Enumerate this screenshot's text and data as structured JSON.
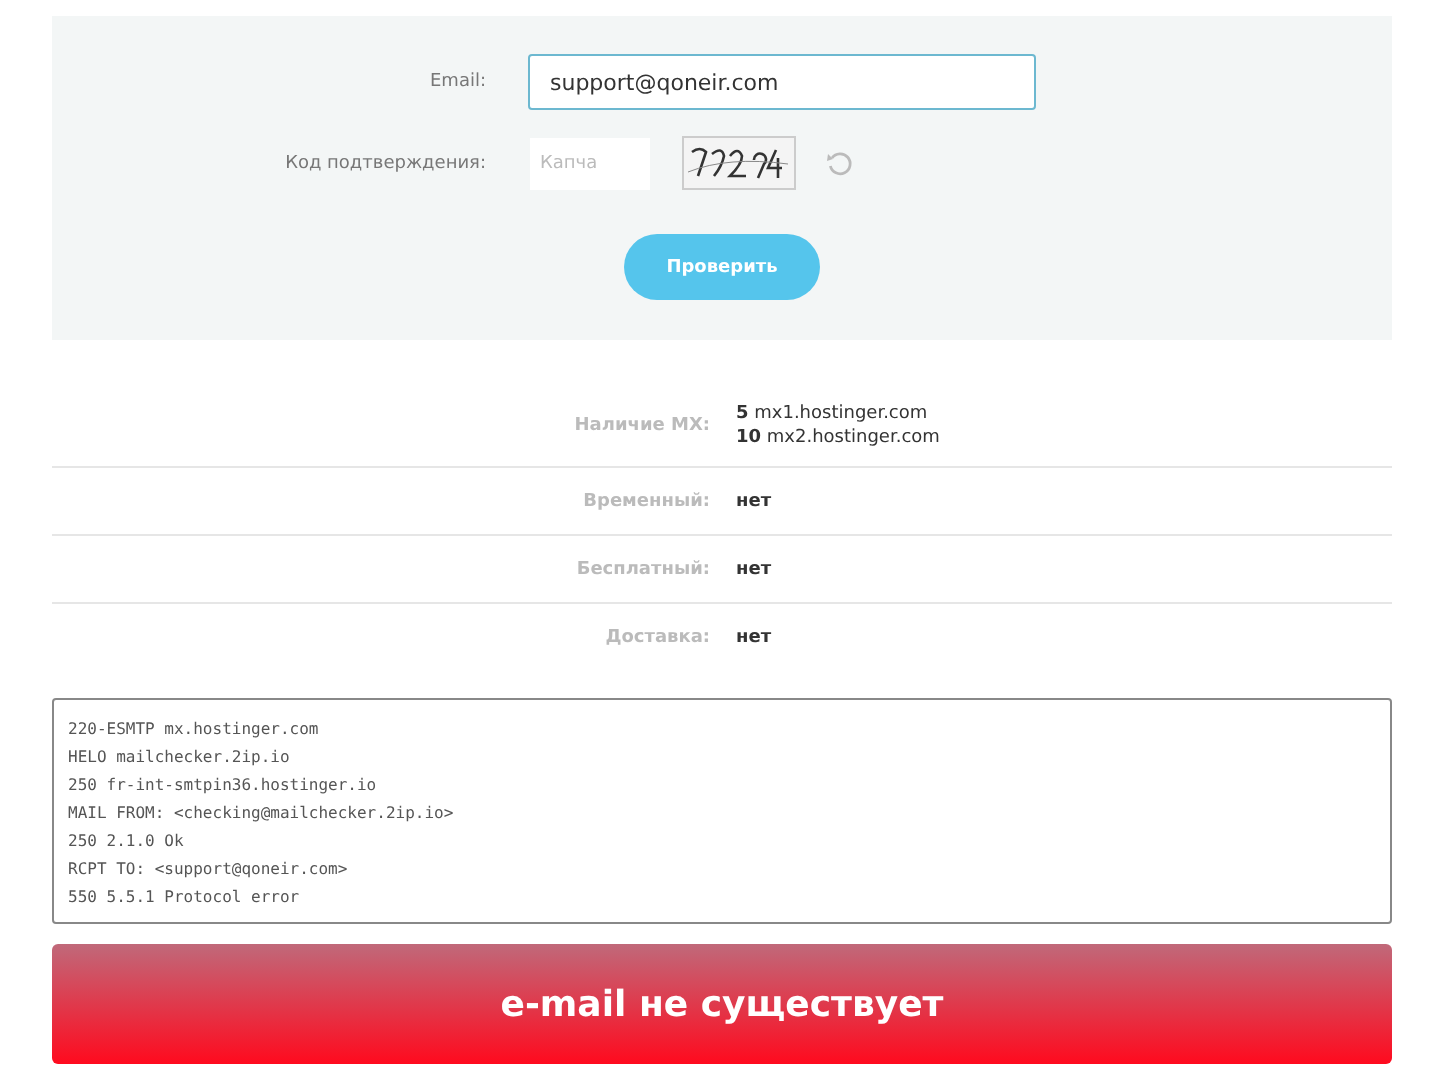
{
  "form": {
    "email_label": "Email:",
    "email_value": "support@qoneir.com",
    "captcha_label": "Код подтверждения:",
    "captcha_placeholder": "Капча",
    "submit": "Проверить"
  },
  "results": [
    {
      "kind": "mx",
      "label": "Наличие MX:",
      "records": [
        {
          "priority": "5",
          "host": "mx1.hostinger.com"
        },
        {
          "priority": "10",
          "host": "mx2.hostinger.com"
        }
      ]
    },
    {
      "kind": "text",
      "label": "Временный:",
      "value": "нет"
    },
    {
      "kind": "text",
      "label": "Бесплатный:",
      "value": "нет"
    },
    {
      "kind": "text",
      "label": "Доставка:",
      "value": "нет"
    }
  ],
  "log": [
    "220-ESMTP mx.hostinger.com",
    "HELO mailchecker.2ip.io",
    "250 fr-int-smtpin36.hostinger.io",
    "MAIL FROM: <checking@mailchecker.2ip.io>",
    "250 2.1.0 Ok",
    "RCPT TO: <support@qoneir.com>",
    "550 5.5.1 Protocol error"
  ],
  "verdict": "e-mail не существует"
}
